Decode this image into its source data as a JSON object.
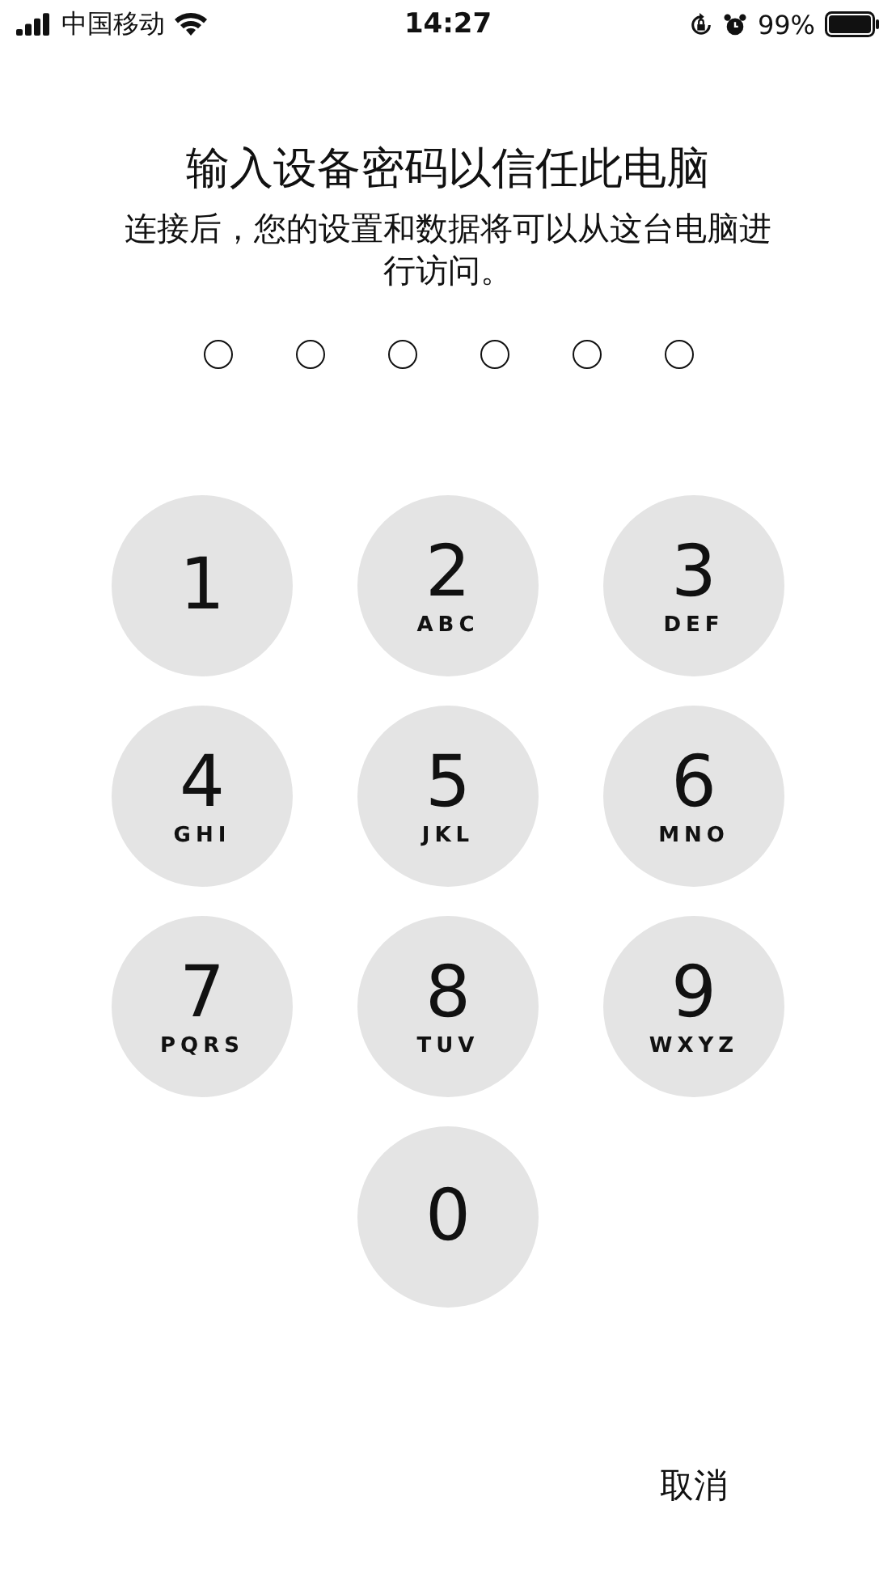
{
  "status_bar": {
    "carrier": "中国移动",
    "time": "14:27",
    "battery": "99%"
  },
  "title": "输入设备密码以信任此电脑",
  "subtitle": "连接后，您的设置和数据将可以从这台电脑进行访问。",
  "passcode_dots": [
    {
      "filled": false
    },
    {
      "filled": false
    },
    {
      "filled": false
    },
    {
      "filled": false
    },
    {
      "filled": false
    },
    {
      "filled": false
    }
  ],
  "keypad": [
    {
      "digit": "1"
    },
    {
      "digit": "2",
      "letters": "ABC"
    },
    {
      "digit": "3",
      "letters": "DEF"
    },
    {
      "digit": "4",
      "letters": "GHI"
    },
    {
      "digit": "5",
      "letters": "JKL"
    },
    {
      "digit": "6",
      "letters": "MNO"
    },
    {
      "digit": "7",
      "letters": "PQRS"
    },
    {
      "digit": "8",
      "letters": "TUV"
    },
    {
      "digit": "9",
      "letters": "WXYZ"
    },
    {
      "digit": "0"
    }
  ],
  "cancel": "取消"
}
